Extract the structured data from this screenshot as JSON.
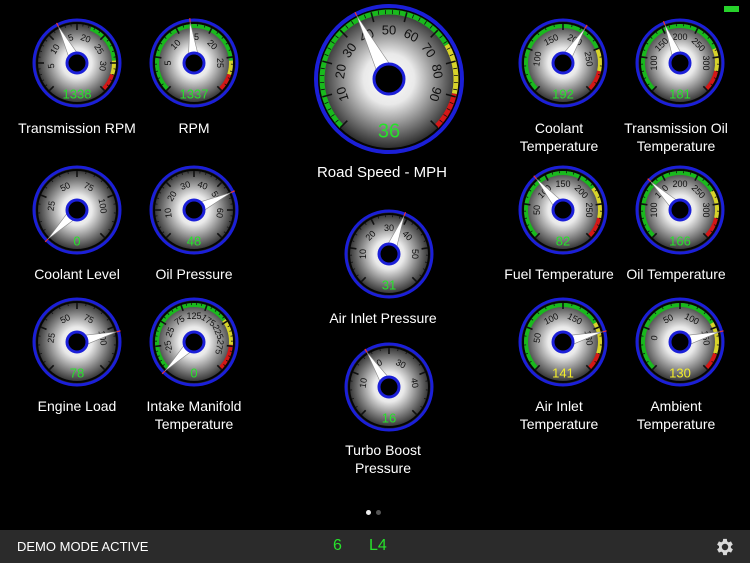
{
  "status_bar": {
    "battery": "battery-icon"
  },
  "colors": {
    "value_green": "#27e12b",
    "value_yellow": "#f5ef2a",
    "ring_blue": "#1b1fd8",
    "accent_green": "#27d22b"
  },
  "gauges": [
    {
      "id": "transmission-rpm",
      "label": "Transmission RPM",
      "value": "1338",
      "value_color": "green",
      "tick_labels": [
        "5",
        "10",
        "15",
        "20",
        "25",
        "30"
      ],
      "needle_fraction": 0.4,
      "bands": [
        [
          0.58,
          0.82,
          "green"
        ],
        [
          0.82,
          0.9,
          "yellow"
        ],
        [
          0.9,
          1,
          "red"
        ]
      ]
    },
    {
      "id": "rpm",
      "label": "RPM",
      "value": "1337",
      "value_color": "green",
      "tick_labels": [
        "5",
        "10",
        "15",
        "20",
        "25"
      ],
      "needle_fraction": 0.48,
      "bands": [
        [
          0,
          0.82,
          "green"
        ],
        [
          0.82,
          0.9,
          "yellow"
        ],
        [
          0.9,
          1,
          "red"
        ]
      ]
    },
    {
      "id": "road-speed",
      "label": "Road Speed - MPH",
      "value": "36",
      "value_color": "green",
      "tick_labels": [
        "10",
        "20",
        "30",
        "40",
        "50",
        "60",
        "70",
        "80",
        "90"
      ],
      "needle_fraction": 0.4,
      "bands": [
        [
          0,
          0.72,
          "green"
        ],
        [
          0.72,
          0.88,
          "yellow"
        ],
        [
          0.88,
          1,
          "red"
        ]
      ]
    },
    {
      "id": "coolant-temperature",
      "label": "Coolant Temperature",
      "value": "192",
      "value_color": "green",
      "tick_labels": [
        "100",
        "150",
        "200",
        "250"
      ],
      "needle_fraction": 0.62,
      "bands": [
        [
          0,
          0.75,
          "green"
        ],
        [
          0.75,
          0.88,
          "yellow"
        ],
        [
          0.88,
          1,
          "red"
        ]
      ]
    },
    {
      "id": "transmission-oil-temperature",
      "label": "Transmission Oil Temperature",
      "value": "181",
      "value_color": "green",
      "tick_labels": [
        "100",
        "150",
        "200",
        "250",
        "300"
      ],
      "needle_fraction": 0.42,
      "bands": [
        [
          0,
          0.75,
          "green"
        ],
        [
          0.75,
          0.88,
          "yellow"
        ],
        [
          0.88,
          1,
          "red"
        ]
      ]
    },
    {
      "id": "coolant-level",
      "label": "Coolant Level",
      "value": "0",
      "value_color": "green",
      "tick_labels": [
        "25",
        "50",
        "75",
        "100"
      ],
      "needle_fraction": 0.0,
      "bands": []
    },
    {
      "id": "oil-pressure",
      "label": "Oil Pressure",
      "value": "48",
      "value_color": "green",
      "tick_labels": [
        "10",
        "20",
        "30",
        "40",
        "50",
        "60"
      ],
      "needle_fraction": 0.74,
      "bands": []
    },
    {
      "id": "air-inlet-pressure",
      "label": "Air Inlet Pressure",
      "value": "31",
      "value_color": "green",
      "tick_labels": [
        "10",
        "20",
        "30",
        "40",
        "50"
      ],
      "needle_fraction": 0.58,
      "bands": []
    },
    {
      "id": "fuel-temperature",
      "label": "Fuel Temperature",
      "value": "82",
      "value_color": "green",
      "tick_labels": [
        "50",
        "100",
        "150",
        "200",
        "250"
      ],
      "needle_fraction": 0.35,
      "bands": [
        [
          0,
          0.7,
          "green"
        ],
        [
          0.7,
          0.88,
          "yellow"
        ],
        [
          0.88,
          1,
          "red"
        ]
      ]
    },
    {
      "id": "oil-temperature",
      "label": "Oil Temperature",
      "value": "166",
      "value_color": "green",
      "tick_labels": [
        "100",
        "150",
        "200",
        "250",
        "300"
      ],
      "needle_fraction": 0.33,
      "bands": [
        [
          0,
          0.72,
          "green"
        ],
        [
          0.72,
          0.88,
          "yellow"
        ],
        [
          0.88,
          1,
          "red"
        ]
      ]
    },
    {
      "id": "engine-load",
      "label": "Engine Load",
      "value": "78",
      "value_color": "green",
      "tick_labels": [
        "25",
        "50",
        "75",
        "100"
      ],
      "needle_fraction": 0.78,
      "bands": []
    },
    {
      "id": "intake-manifold-temperature",
      "label": "Intake Manifold Temperature",
      "value": "0",
      "value_color": "green",
      "tick_labels": [
        "-25",
        "25",
        "75",
        "125",
        "175",
        "225",
        "275"
      ],
      "needle_fraction": 0.0,
      "bands": [
        [
          0,
          0.7,
          "green"
        ],
        [
          0.7,
          0.85,
          "yellow"
        ],
        [
          0.85,
          1,
          "red"
        ]
      ]
    },
    {
      "id": "air-inlet-temperature",
      "label": "Air Inlet Temperature",
      "value": "141",
      "value_color": "yellow",
      "tick_labels": [
        "50",
        "100",
        "150",
        "180"
      ],
      "needle_fraction": 0.78,
      "bands": [
        [
          0,
          0.72,
          "green"
        ],
        [
          0.72,
          0.9,
          "yellow"
        ],
        [
          0.9,
          1,
          "red"
        ]
      ]
    },
    {
      "id": "ambient-temperature",
      "label": "Ambient Temperature",
      "value": "130",
      "value_color": "yellow",
      "tick_labels": [
        "0",
        "50",
        "100",
        "150"
      ],
      "needle_fraction": 0.78,
      "bands": [
        [
          0,
          0.72,
          "green"
        ],
        [
          0.72,
          0.9,
          "yellow"
        ],
        [
          0.9,
          1,
          "red"
        ]
      ]
    },
    {
      "id": "turbo-boost-pressure",
      "label": "Turbo Boost Pressure",
      "value": "16",
      "value_color": "green",
      "tick_labels": [
        "10",
        "20",
        "30",
        "40"
      ],
      "needle_fraction": 0.38,
      "bands": []
    }
  ],
  "pager": {
    "pages": 2,
    "current": 1
  },
  "bottom_bar": {
    "demo_mode": "DEMO MODE ACTIVE",
    "gear": "6",
    "mode": "L4",
    "settings_icon": "gear-icon"
  }
}
